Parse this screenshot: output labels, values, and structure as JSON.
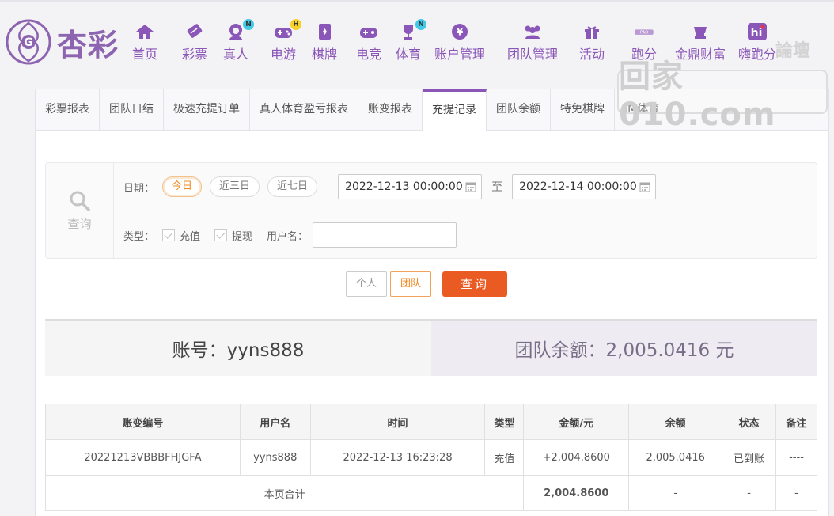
{
  "header": {
    "logo_text": "杏彩",
    "nav": [
      {
        "label": "首页",
        "icon": "home-icon",
        "badge": ""
      },
      {
        "label": "彩票",
        "icon": "lottery-icon",
        "badge": ""
      },
      {
        "label": "真人",
        "icon": "live-dealer-icon",
        "badge": "N"
      },
      {
        "label": "电游",
        "icon": "gamepad-icon",
        "badge": "H"
      },
      {
        "label": "棋牌",
        "icon": "cards-icon",
        "badge": ""
      },
      {
        "label": "电竞",
        "icon": "esports-controller-icon",
        "badge": ""
      },
      {
        "label": "体育",
        "icon": "trophy-icon",
        "badge": "N"
      },
      {
        "label": "账户管理",
        "icon": "account-yen-icon",
        "badge": ""
      },
      {
        "label": "团队管理",
        "icon": "team-icon",
        "badge": ""
      },
      {
        "label": "活动",
        "icon": "gift-icon",
        "badge": ""
      },
      {
        "label": "跑分",
        "icon": "running-score-icon",
        "badge": ""
      },
      {
        "label": "金鼎财富",
        "icon": "treasure-icon",
        "badge": ""
      },
      {
        "label": "嗨跑分",
        "icon": "hi-icon",
        "badge": ""
      }
    ],
    "watermark": "回家010.com",
    "watermark_top": "論壇"
  },
  "tabs": [
    "彩票报表",
    "团队日结",
    "极速充提订单",
    "真人体育盈亏报表",
    "账变报表",
    "充提记录",
    "团队余额",
    "特免棋牌",
    "IM体育"
  ],
  "active_tab_index": 5,
  "search": {
    "side_label": "查询",
    "date_label": "日期：",
    "quick": [
      "今日",
      "近三日",
      "近七日"
    ],
    "start_date": "2022-12-13 00:00:00",
    "to_label": "至",
    "end_date": "2022-12-14 00:00:00",
    "type_label": "类型：",
    "type_deposit": "充值",
    "type_withdraw": "提现",
    "username_label": "用户名：",
    "username_value": ""
  },
  "buttons": {
    "personal": "个人",
    "team": "团队",
    "query": "查询"
  },
  "summary": {
    "account": "账号：yyns888",
    "team_balance": "团队余额：2,005.0416 元"
  },
  "table": {
    "headers": [
      "账变编号",
      "用户名",
      "时间",
      "类型",
      "金额/元",
      "余额",
      "状态",
      "备注"
    ],
    "rows": [
      {
        "id": "20221213VBBBFHJGFA",
        "user": "yyns888",
        "time": "2022-12-13 16:23:28",
        "type": "充值",
        "amount": "+2,004.8600",
        "balance": "2,005.0416",
        "status": "已到账",
        "note": "----"
      }
    ],
    "total": {
      "label": "本页合计",
      "amount": "2,004.8600",
      "balance": "-",
      "status": "-",
      "note": "-"
    }
  },
  "colors": {
    "brand": "#8a56b8",
    "accent": "#ea5b24",
    "positive": "#3fa34a"
  }
}
